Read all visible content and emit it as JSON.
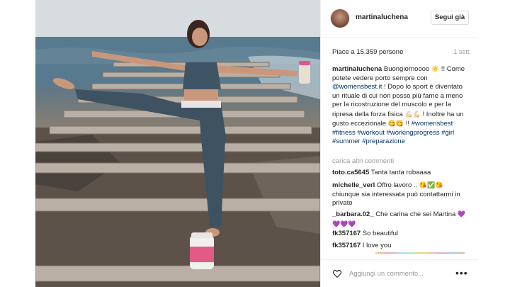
{
  "post": {
    "username": "martinaluchena",
    "follow_label": "Segui già",
    "likes_text": "Piace a 15.359 persone",
    "time": "1 sett.",
    "caption": {
      "username": "martinaluchena",
      "text_1": " Buongiornoooo ",
      "text_2": " !! Come potete vedere porto sempre con ",
      "mention": "@womensbest.it",
      "text_3": " ! Dopo lo sport è diventato un rituale di cui non posso più farne a meno per la ricostruzione del muscolo e per la ripresa della forza fisica ",
      "text_4": " ! Inoltre ha un gusto eccezionale ",
      "text_5": " !! ",
      "hashtags": "#womensbest #fitness #workout #workingprogress #girl #summer #preparazione"
    },
    "load_more": "carica altri commenti",
    "comments": [
      {
        "user": "toto.ca5645",
        "text": " Tanta tanta robaaaa"
      },
      {
        "user": "michelle_verl",
        "text": " Offro lavoro .. ",
        "text_after": " chiunque sia interessata può contattarmi in privato"
      },
      {
        "user": "_barbara.02_",
        "text": " Che carina che sei Martina "
      },
      {
        "user": "fk357167",
        "text": " So beautiful"
      },
      {
        "user": "fk357167",
        "text": " I love you"
      }
    ],
    "add_comment_placeholder": "Aggiungi un commento...",
    "more_options": "•••"
  },
  "icons": {
    "heart": "heart-outline-icon",
    "more": "more-options-icon"
  },
  "colors": {
    "text": "#262626",
    "muted": "#999999",
    "link": "#003569",
    "border": "#efefef"
  }
}
